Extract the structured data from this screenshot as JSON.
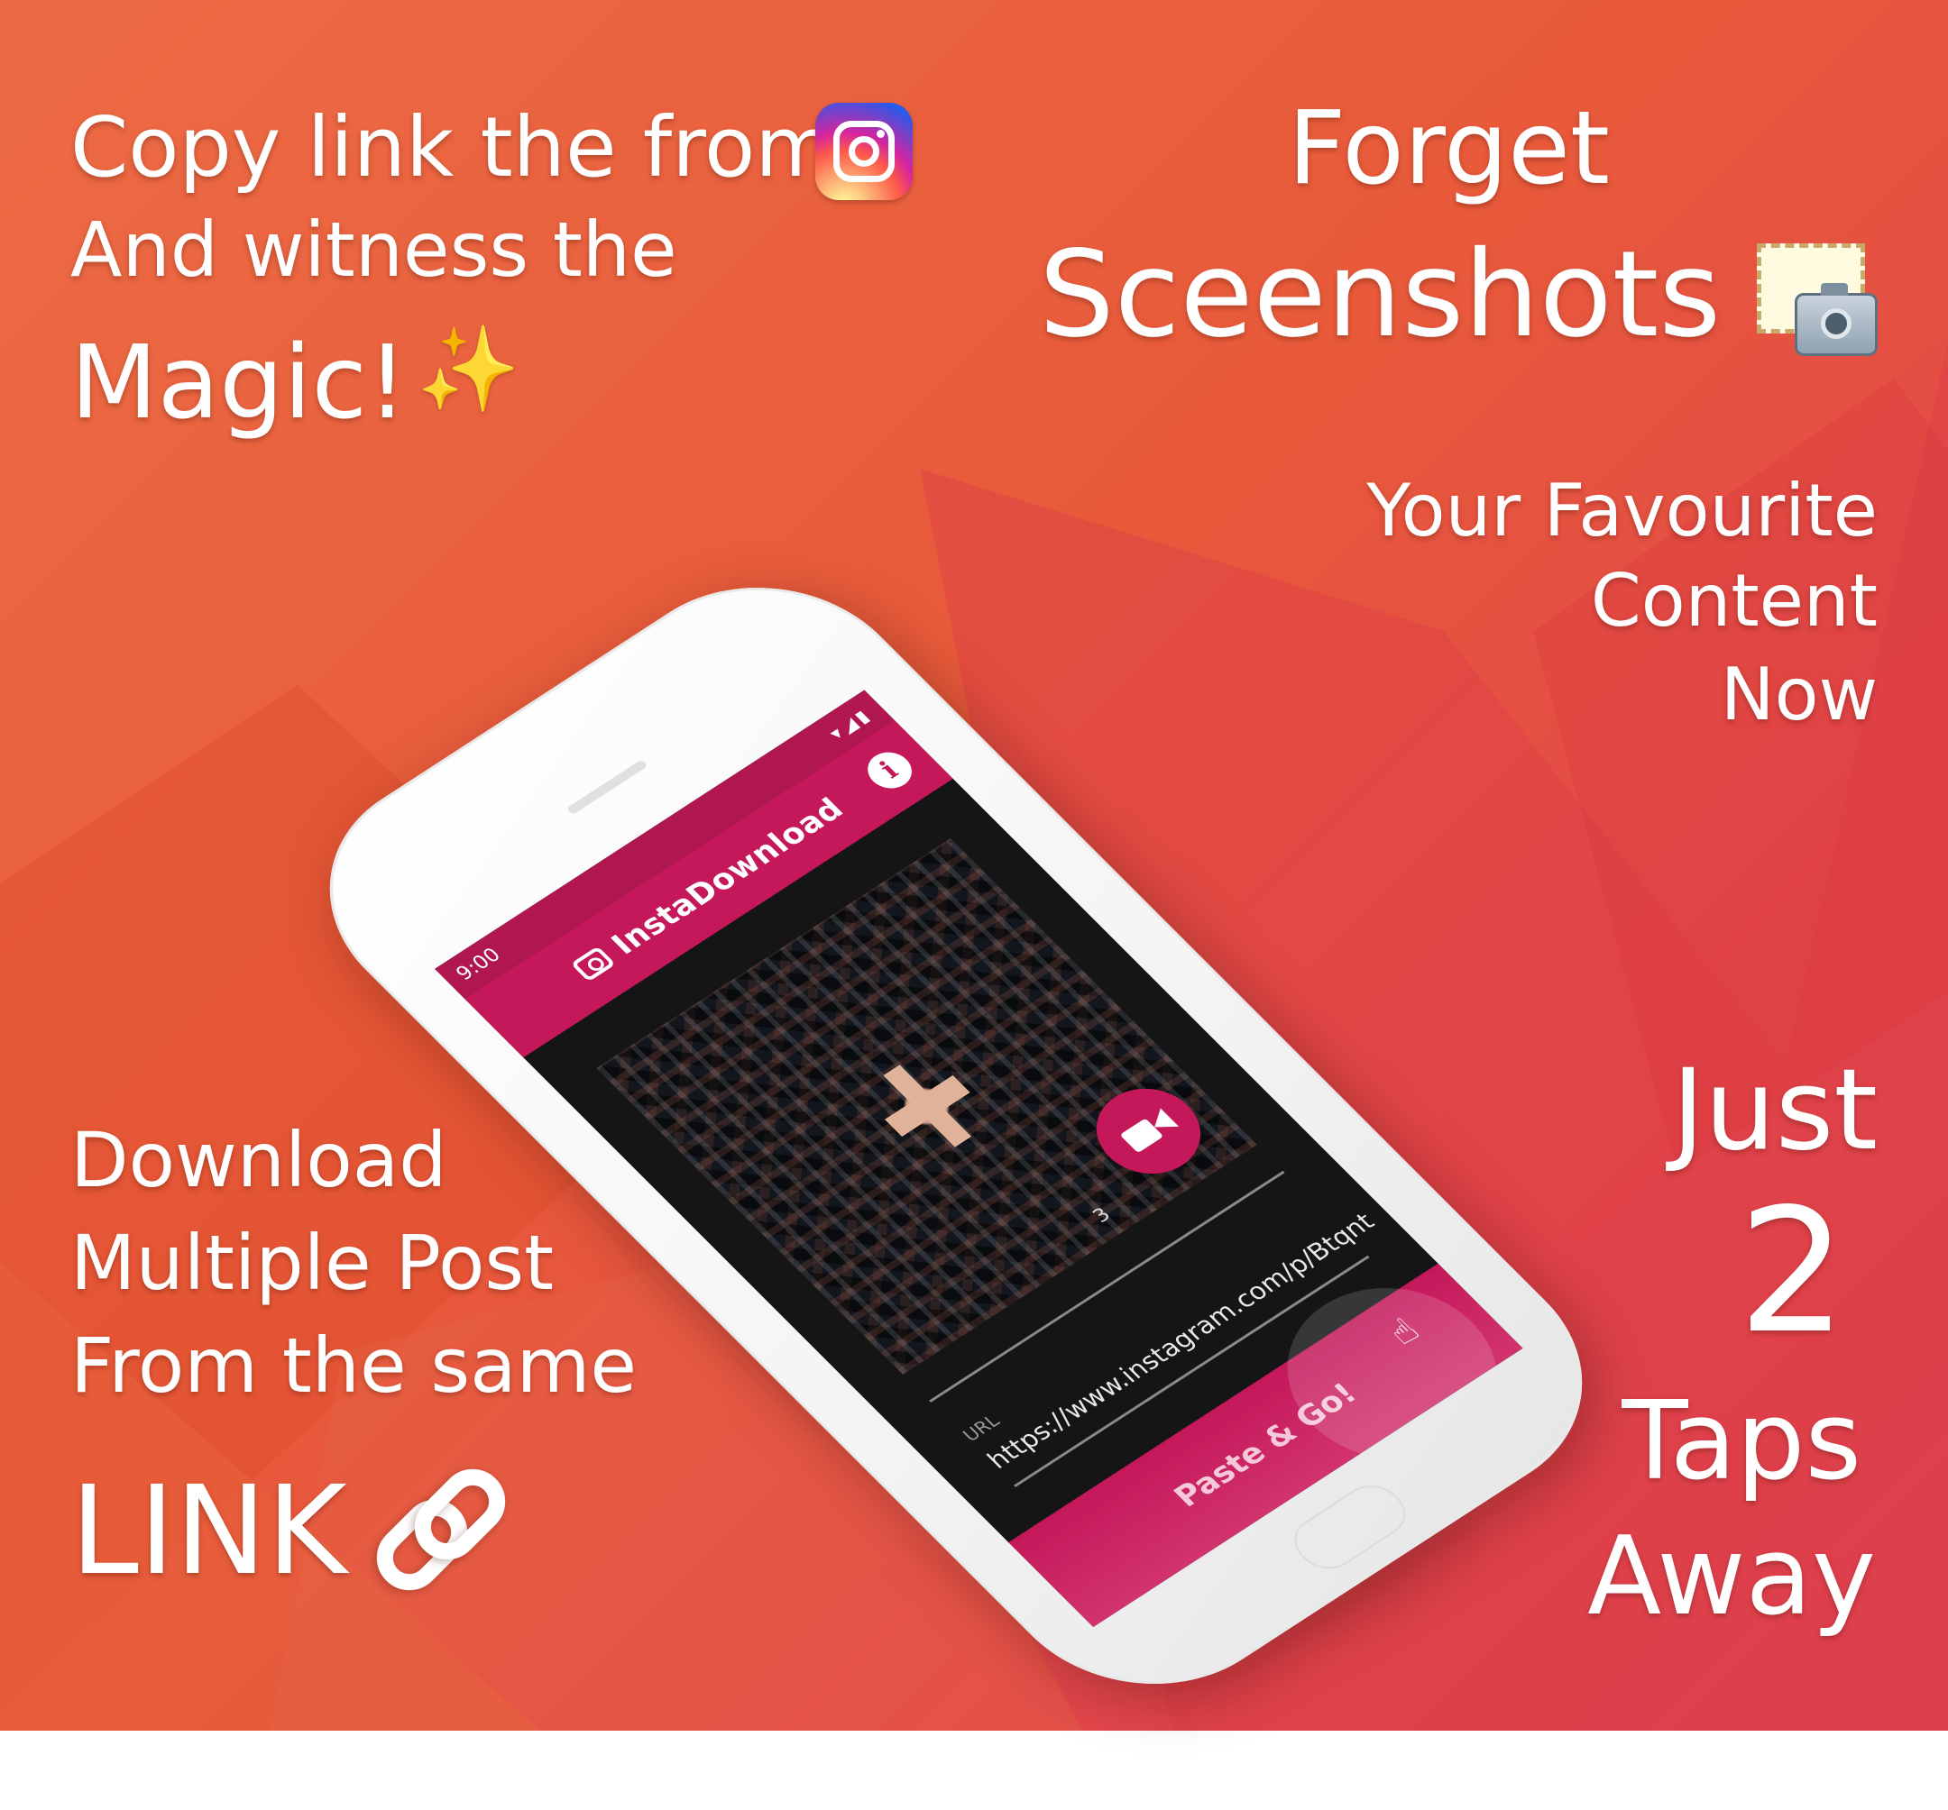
{
  "top_left": {
    "line1": "Copy link the from",
    "line2": "And witness the",
    "line3": "Magic!"
  },
  "top_right": {
    "line1": "Forget",
    "line2": "Sceenshots"
  },
  "mid_right": {
    "line1": "Your Favourite",
    "line2": "Content",
    "line3": "Now"
  },
  "bottom_left": {
    "line1": "Download",
    "line2": "Multiple Post",
    "line3": "From the same",
    "line4": "LINK"
  },
  "bottom_right": {
    "line1": "Just",
    "line2": "2",
    "line3": "Taps",
    "line4": "Away"
  },
  "phone": {
    "status_time": "9:00",
    "status_icons": "▾◢▮",
    "app_title": "InstaDownload",
    "info_label": "i",
    "page_number": "3",
    "url_label": "URL",
    "url_value": "https://www.instagram.com/p/Btqnt",
    "paste_button": "Paste & Go!"
  },
  "icons": [
    "instagram-icon",
    "sparkle-icon",
    "screenshot-icon",
    "link-icon",
    "video-camera-icon",
    "camera-icon",
    "info-icon",
    "hand-pointer-icon"
  ],
  "colors": {
    "background": "#e85a3a",
    "accent": "#c4185a",
    "text": "#ffffff"
  }
}
